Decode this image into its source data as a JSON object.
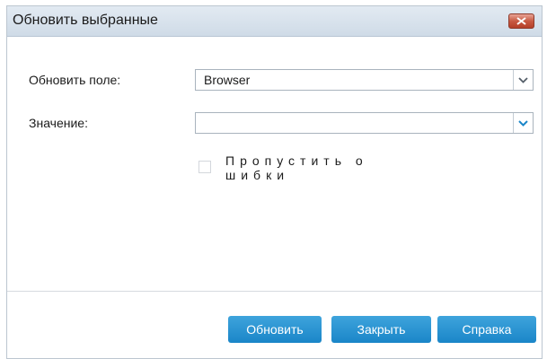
{
  "dialog": {
    "title": "Обновить выбранные",
    "close_icon": "close-x-icon"
  },
  "form": {
    "update_field_label": "Обновить поле:",
    "update_field_value": "Browser",
    "value_label": "Значение:",
    "value_value": "",
    "skip_errors_label": "Пропустить ошибки",
    "skip_errors_checked": false
  },
  "buttons": {
    "update": "Обновить",
    "close": "Закрыть",
    "help": "Справка"
  },
  "colors": {
    "accent": "#1a86c8",
    "close_red": "#c85a43"
  }
}
